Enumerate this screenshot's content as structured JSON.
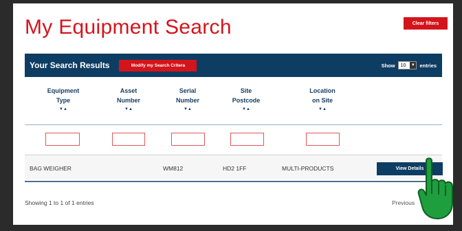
{
  "page": {
    "title": "My Equipment Search",
    "clear_filters_label": "Clear filters"
  },
  "results_bar": {
    "title": "Your Search Results",
    "modify_label": "Modify my Search Critera",
    "show_label": "Show",
    "entries_value": "10",
    "entries_label": "entries"
  },
  "columns": [
    {
      "line1": "Equipment",
      "line2": "Type"
    },
    {
      "line1": "Asset",
      "line2": "Number"
    },
    {
      "line1": "Serial",
      "line2": "Number"
    },
    {
      "line1": "Site",
      "line2": "Postcode"
    },
    {
      "line1": "Location",
      "line2": "on Site"
    }
  ],
  "sort_icon": "sort-arrows-icon",
  "rows": [
    {
      "equipment_type": "BAG WEIGHER",
      "asset_number": "",
      "serial_number": "WM812",
      "site_postcode": "HD2 1FF",
      "location_on_site": "MULTI-PRODUCTS",
      "action_label": "View Details"
    }
  ],
  "footer": {
    "info": "Showing 1 to 1 of 1 entries",
    "previous_label": "Previous"
  },
  "colors": {
    "brand_red": "#d4141b",
    "navy": "#0e3d63",
    "hand_green": "#1f9e3e"
  }
}
